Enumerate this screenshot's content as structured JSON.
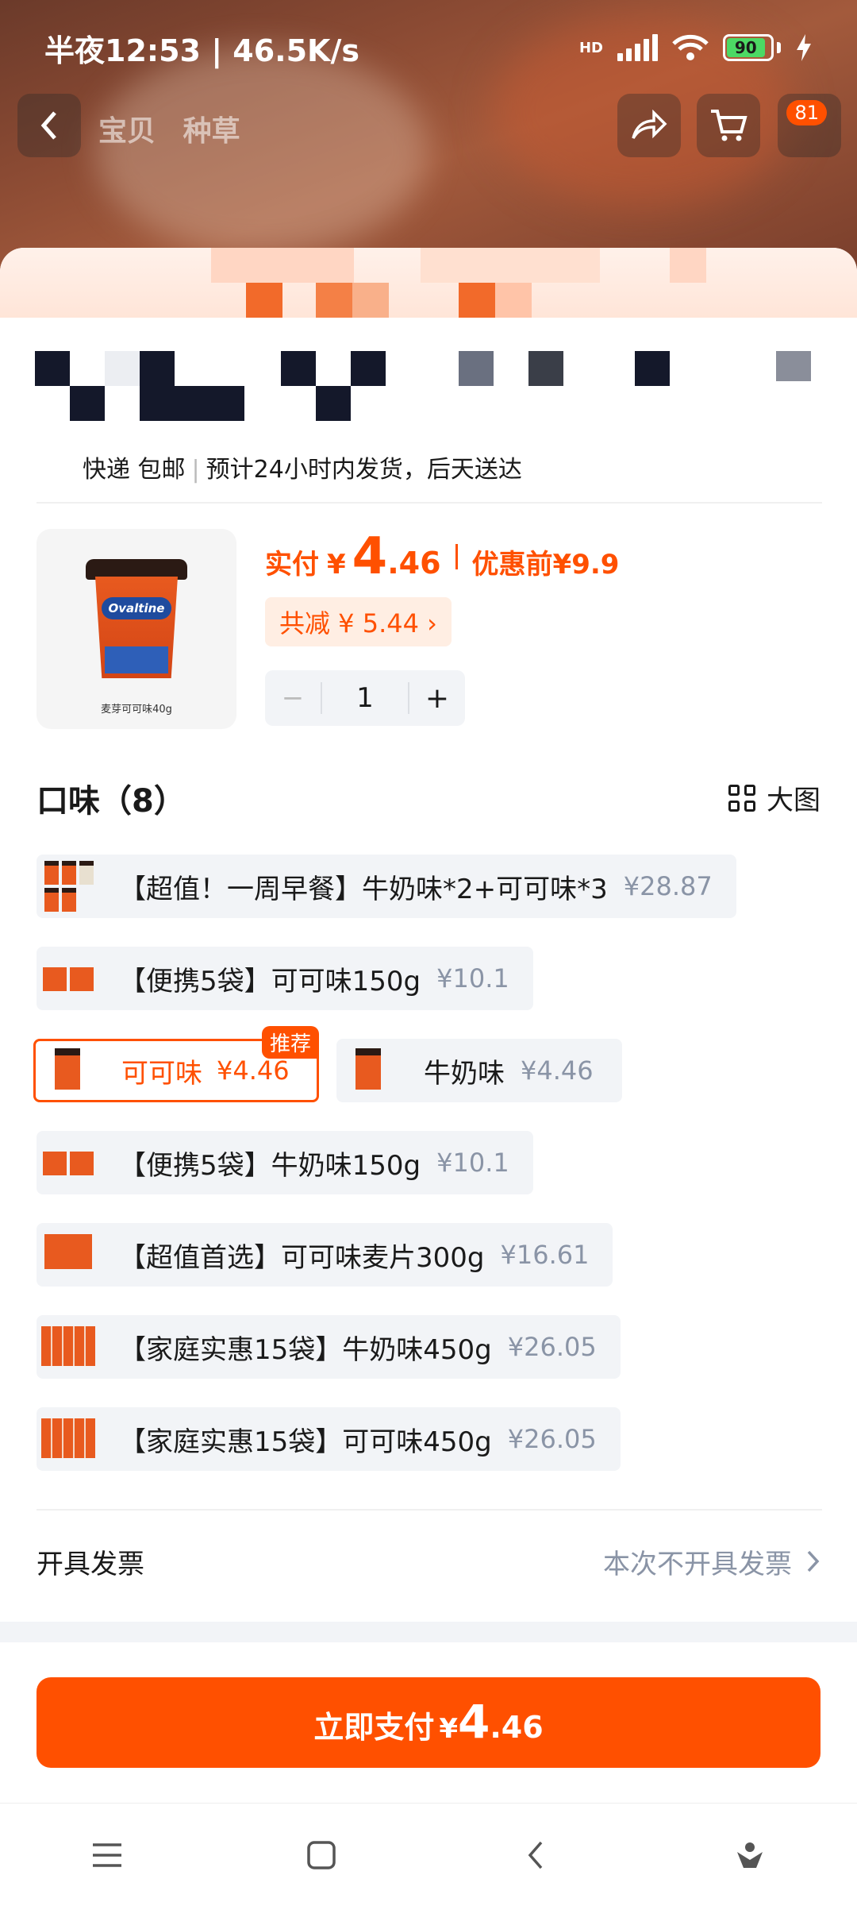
{
  "status_bar": {
    "time": "半夜12:53 | 46.5K/s",
    "network": "HD",
    "battery": "90"
  },
  "nav": {
    "tab_item": "宝贝",
    "tab_review": "种草",
    "cart_badge": "81"
  },
  "shipping": {
    "method": "快递 包邮",
    "estimate": "预计24小时内发货，后天送达"
  },
  "product": {
    "image_caption": "麦芽可可味40g",
    "logo_text": "Ovaltine",
    "paid_label": "实付",
    "currency": "¥",
    "price_int": "4",
    "price_dec": ".46",
    "before_label": "优惠前",
    "before_price": "¥9.9",
    "discount_text": "共减 ¥ 5.44 ›",
    "quantity": "1",
    "minus": "−",
    "plus": "+"
  },
  "flavor": {
    "title": "口味（8）",
    "big_image_label": "大图",
    "recommend_badge": "推荐",
    "options": [
      {
        "name": "【超值！一周早餐】牛奶味*2+可可味*3",
        "price": "¥28.87"
      },
      {
        "name": "【便携5袋】可可味150g",
        "price": "¥10.1"
      },
      {
        "name": "可可味",
        "price": "¥4.46"
      },
      {
        "name": "牛奶味",
        "price": "¥4.46"
      },
      {
        "name": "【便携5袋】牛奶味150g",
        "price": "¥10.1"
      },
      {
        "name": "【超值首选】可可味麦片300g",
        "price": "¥16.61"
      },
      {
        "name": "【家庭实惠15袋】牛奶味450g",
        "price": "¥26.05"
      },
      {
        "name": "【家庭实惠15袋】可可味450g",
        "price": "¥26.05"
      }
    ]
  },
  "invoice": {
    "label": "开具发票",
    "value": "本次不开具发票"
  },
  "pay_button": {
    "label": "立即支付",
    "currency": "¥",
    "int": "4",
    "dec": ".46"
  },
  "colors": {
    "accent": "#ff5000",
    "chip_bg": "#f2f4f7",
    "muted": "#8a94a6"
  }
}
